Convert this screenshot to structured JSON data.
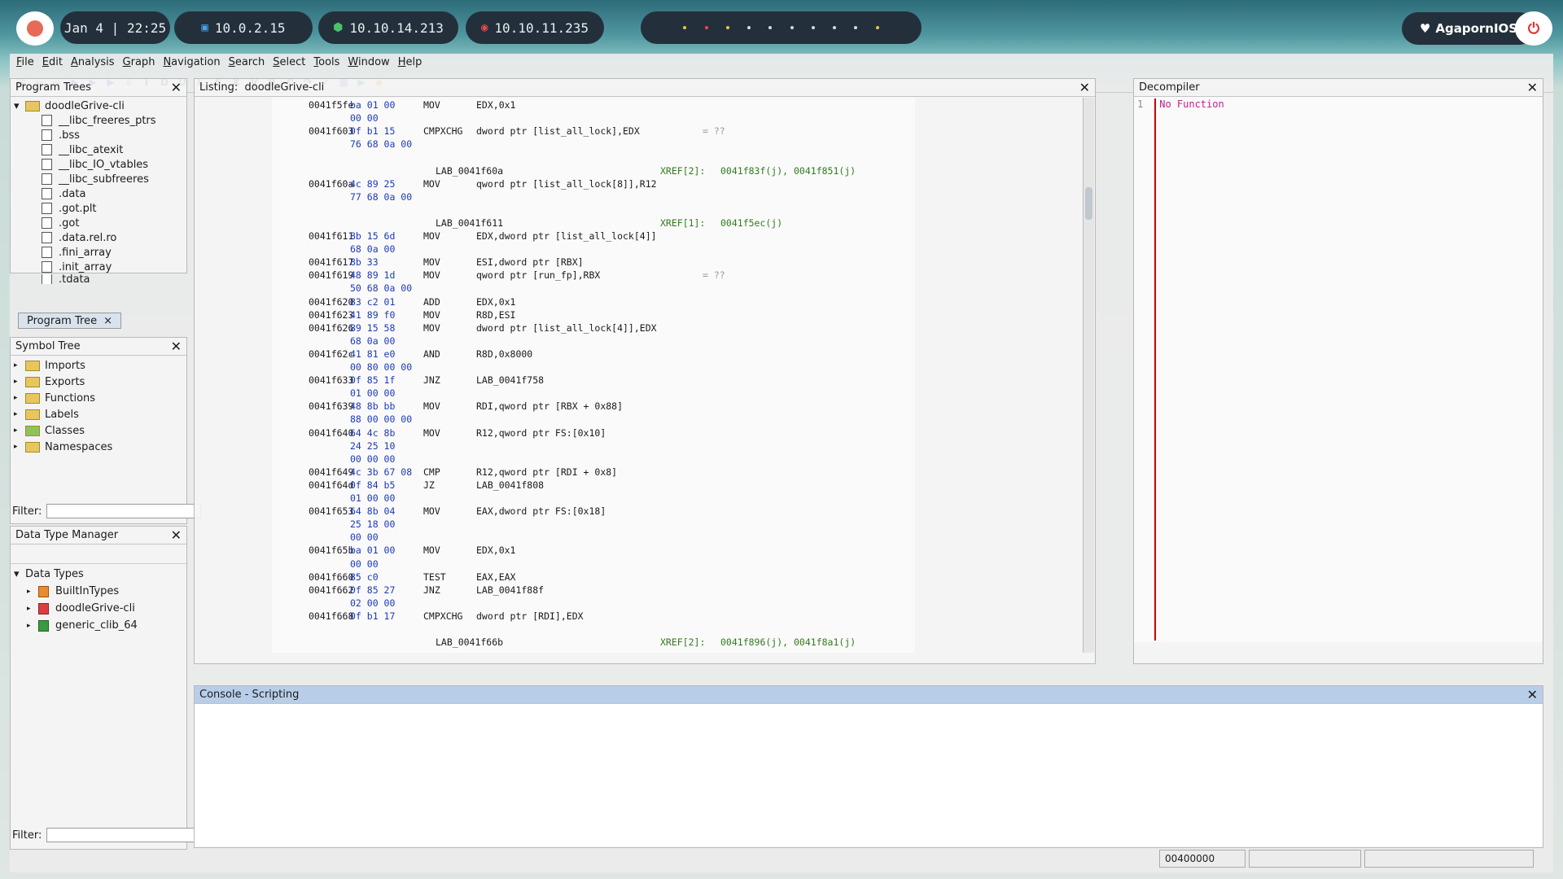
{
  "topbar": {
    "datetime": "Jan 4 | 22:25",
    "ip1": "10.0.2.15",
    "ip2": "10.10.14.213",
    "ip3": "10.10.11.235",
    "user": "AgapornIOS"
  },
  "menu": [
    "File",
    "Edit",
    "Analysis",
    "Graph",
    "Navigation",
    "Search",
    "Select",
    "Tools",
    "Window",
    "Help"
  ],
  "program_trees": {
    "title": "Program Trees",
    "root": "doodleGrive-cli",
    "items": [
      "__libc_freeres_ptrs",
      ".bss",
      "__libc_atexit",
      "__libc_IO_vtables",
      "__libc_subfreeres",
      ".data",
      ".got.plt",
      ".got",
      ".data.rel.ro",
      ".fini_array",
      ".init_array",
      ".tdata"
    ],
    "tab": "Program Tree"
  },
  "symbol_tree": {
    "title": "Symbol Tree",
    "items": [
      "Imports",
      "Exports",
      "Functions",
      "Labels",
      "Classes",
      "Namespaces"
    ],
    "filter_label": "Filter:"
  },
  "data_type_manager": {
    "title": "Data Type Manager",
    "root": "Data Types",
    "items": [
      "BuiltInTypes",
      "doodleGrive-cli",
      "generic_clib_64"
    ],
    "filter_label": "Filter:"
  },
  "listing": {
    "title": "Listing:",
    "program": "doodleGrive-cli",
    "lines": [
      {
        "addr": "0041f5fe",
        "bytes": "ba 01 00",
        "mn": "MOV",
        "op": "EDX,0x1"
      },
      {
        "addr": "",
        "bytes": "00 00",
        "mn": "",
        "op": ""
      },
      {
        "addr": "0041f603",
        "bytes": "0f b1 15",
        "mn": "CMPXCHG",
        "op": "dword ptr [list_all_lock],EDX",
        "cmt": "= ??"
      },
      {
        "addr": "",
        "bytes": "76 68 0a 00",
        "mn": "",
        "op": ""
      },
      {
        "addr": "",
        "bytes": "",
        "mn": "",
        "op": ""
      },
      {
        "label": "LAB_0041f60a",
        "xref": "XREF[2]:",
        "xrefv": "0041f83f(j), 0041f851(j)"
      },
      {
        "addr": "0041f60a",
        "bytes": "4c 89 25",
        "mn": "MOV",
        "op": "qword ptr [list_all_lock[8]],R12"
      },
      {
        "addr": "",
        "bytes": "77 68 0a 00",
        "mn": "",
        "op": ""
      },
      {
        "addr": "",
        "bytes": "",
        "mn": "",
        "op": ""
      },
      {
        "label": "LAB_0041f611",
        "xref": "XREF[1]:",
        "xrefv": "0041f5ec(j)"
      },
      {
        "addr": "0041f611",
        "bytes": "8b 15 6d",
        "mn": "MOV",
        "op": "EDX,dword ptr [list_all_lock[4]]"
      },
      {
        "addr": "",
        "bytes": "68 0a 00",
        "mn": "",
        "op": ""
      },
      {
        "addr": "0041f617",
        "bytes": "8b 33",
        "mn": "MOV",
        "op": "ESI,dword ptr [RBX]"
      },
      {
        "addr": "0041f619",
        "bytes": "48 89 1d",
        "mn": "MOV",
        "op": "qword ptr [run_fp],RBX",
        "cmt": "= ??"
      },
      {
        "addr": "",
        "bytes": "50 68 0a 00",
        "mn": "",
        "op": ""
      },
      {
        "addr": "0041f620",
        "bytes": "83 c2 01",
        "mn": "ADD",
        "op": "EDX,0x1"
      },
      {
        "addr": "0041f623",
        "bytes": "41 89 f0",
        "mn": "MOV",
        "op": "R8D,ESI"
      },
      {
        "addr": "0041f626",
        "bytes": "89 15 58",
        "mn": "MOV",
        "op": "dword ptr [list_all_lock[4]],EDX"
      },
      {
        "addr": "",
        "bytes": "68 0a 00",
        "mn": "",
        "op": ""
      },
      {
        "addr": "0041f62c",
        "bytes": "41 81 e0",
        "mn": "AND",
        "op": "R8D,0x8000"
      },
      {
        "addr": "",
        "bytes": "00 80 00 00",
        "mn": "",
        "op": ""
      },
      {
        "addr": "0041f633",
        "bytes": "0f 85 1f",
        "mn": "JNZ",
        "op": "LAB_0041f758"
      },
      {
        "addr": "",
        "bytes": "01 00 00",
        "mn": "",
        "op": ""
      },
      {
        "addr": "0041f639",
        "bytes": "48 8b bb",
        "mn": "MOV",
        "op": "RDI,qword ptr [RBX + 0x88]"
      },
      {
        "addr": "",
        "bytes": "88 00 00 00",
        "mn": "",
        "op": ""
      },
      {
        "addr": "0041f640",
        "bytes": "64 4c 8b",
        "mn": "MOV",
        "op": "R12,qword ptr FS:[0x10]"
      },
      {
        "addr": "",
        "bytes": "24 25 10",
        "mn": "",
        "op": ""
      },
      {
        "addr": "",
        "bytes": "00 00 00",
        "mn": "",
        "op": ""
      },
      {
        "addr": "0041f649",
        "bytes": "4c 3b 67 08",
        "mn": "CMP",
        "op": "R12,qword ptr [RDI + 0x8]"
      },
      {
        "addr": "0041f64d",
        "bytes": "0f 84 b5",
        "mn": "JZ",
        "op": "LAB_0041f808"
      },
      {
        "addr": "",
        "bytes": "01 00 00",
        "mn": "",
        "op": ""
      },
      {
        "addr": "0041f653",
        "bytes": "64 8b 04",
        "mn": "MOV",
        "op": "EAX,dword ptr FS:[0x18]"
      },
      {
        "addr": "",
        "bytes": "25 18 00",
        "mn": "",
        "op": ""
      },
      {
        "addr": "",
        "bytes": "00 00",
        "mn": "",
        "op": ""
      },
      {
        "addr": "0041f65b",
        "bytes": "ba 01 00",
        "mn": "MOV",
        "op": "EDX,0x1"
      },
      {
        "addr": "",
        "bytes": "00 00",
        "mn": "",
        "op": ""
      },
      {
        "addr": "0041f660",
        "bytes": "85 c0",
        "mn": "TEST",
        "op": "EAX,EAX"
      },
      {
        "addr": "0041f662",
        "bytes": "0f 85 27",
        "mn": "JNZ",
        "op": "LAB_0041f88f"
      },
      {
        "addr": "",
        "bytes": "02 00 00",
        "mn": "",
        "op": ""
      },
      {
        "addr": "0041f668",
        "bytes": "0f b1 17",
        "mn": "CMPXCHG",
        "op": "dword ptr [RDI],EDX"
      },
      {
        "addr": "",
        "bytes": "",
        "mn": "",
        "op": ""
      },
      {
        "label": "LAB_0041f66b",
        "xref": "XREF[2]:",
        "xrefv": "0041f896(j), 0041f8a1(j)"
      }
    ]
  },
  "decompiler": {
    "title": "Decompiler",
    "line_no": "1",
    "text": "No Function"
  },
  "console": {
    "title": "Console - Scripting"
  },
  "status": {
    "address": "00400000"
  }
}
